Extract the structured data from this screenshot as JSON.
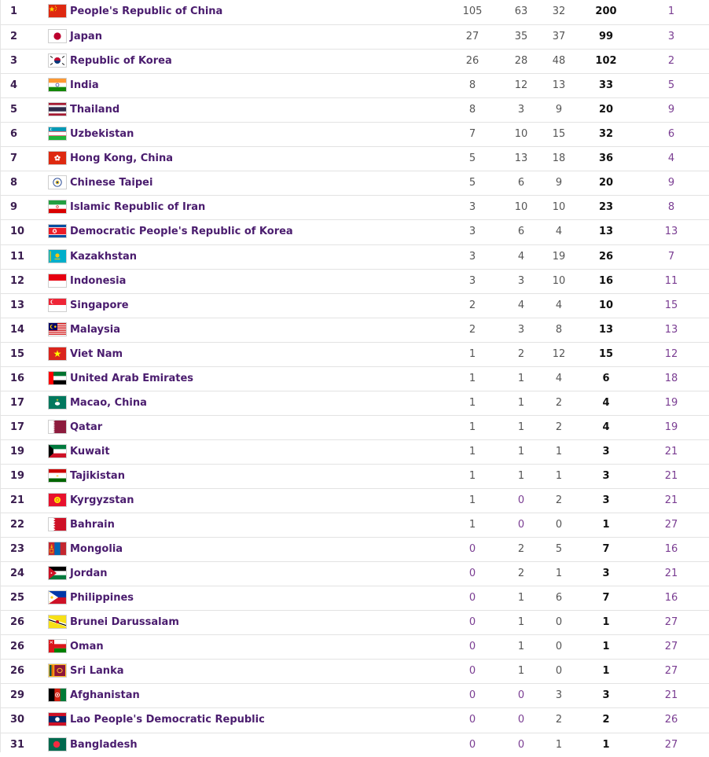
{
  "colors": {
    "name_text": "#4a1c6e",
    "rank_text": "#3a1d4f",
    "link_purple": "#7a3d92",
    "row_border": "#e3e3e3"
  },
  "rows": [
    {
      "rank": "1",
      "name": "People's Republic of China",
      "flag": "china-flag",
      "gold": "105",
      "silver": "63",
      "bronze": "32",
      "total": "200",
      "rank_by_total": "1"
    },
    {
      "rank": "2",
      "name": "Japan",
      "flag": "japan-flag",
      "gold": "27",
      "silver": "35",
      "bronze": "37",
      "total": "99",
      "rank_by_total": "3"
    },
    {
      "rank": "3",
      "name": "Republic of Korea",
      "flag": "south-korea-flag",
      "gold": "26",
      "silver": "28",
      "bronze": "48",
      "total": "102",
      "rank_by_total": "2"
    },
    {
      "rank": "4",
      "name": "India",
      "flag": "india-flag",
      "gold": "8",
      "silver": "12",
      "bronze": "13",
      "total": "33",
      "rank_by_total": "5"
    },
    {
      "rank": "5",
      "name": "Thailand",
      "flag": "thailand-flag",
      "gold": "8",
      "silver": "3",
      "bronze": "9",
      "total": "20",
      "rank_by_total": "9"
    },
    {
      "rank": "6",
      "name": "Uzbekistan",
      "flag": "uzbekistan-flag",
      "gold": "7",
      "silver": "10",
      "bronze": "15",
      "total": "32",
      "rank_by_total": "6"
    },
    {
      "rank": "7",
      "name": "Hong Kong, China",
      "flag": "hong-kong-flag",
      "gold": "5",
      "silver": "13",
      "bronze": "18",
      "total": "36",
      "rank_by_total": "4"
    },
    {
      "rank": "8",
      "name": "Chinese Taipei",
      "flag": "chinese-taipei-flag",
      "gold": "5",
      "silver": "6",
      "bronze": "9",
      "total": "20",
      "rank_by_total": "9"
    },
    {
      "rank": "9",
      "name": "Islamic Republic of Iran",
      "flag": "iran-flag",
      "gold": "3",
      "silver": "10",
      "bronze": "10",
      "total": "23",
      "rank_by_total": "8"
    },
    {
      "rank": "10",
      "name": "Democratic People's Republic of Korea",
      "flag": "north-korea-flag",
      "gold": "3",
      "silver": "6",
      "bronze": "4",
      "total": "13",
      "rank_by_total": "13"
    },
    {
      "rank": "11",
      "name": "Kazakhstan",
      "flag": "kazakhstan-flag",
      "gold": "3",
      "silver": "4",
      "bronze": "19",
      "total": "26",
      "rank_by_total": "7"
    },
    {
      "rank": "12",
      "name": "Indonesia",
      "flag": "indonesia-flag",
      "gold": "3",
      "silver": "3",
      "bronze": "10",
      "total": "16",
      "rank_by_total": "11"
    },
    {
      "rank": "13",
      "name": "Singapore",
      "flag": "singapore-flag",
      "gold": "2",
      "silver": "4",
      "bronze": "4",
      "total": "10",
      "rank_by_total": "15"
    },
    {
      "rank": "14",
      "name": "Malaysia",
      "flag": "malaysia-flag",
      "gold": "2",
      "silver": "3",
      "bronze": "8",
      "total": "13",
      "rank_by_total": "13"
    },
    {
      "rank": "15",
      "name": "Viet Nam",
      "flag": "vietnam-flag",
      "gold": "1",
      "silver": "2",
      "bronze": "12",
      "total": "15",
      "rank_by_total": "12"
    },
    {
      "rank": "16",
      "name": "United Arab Emirates",
      "flag": "uae-flag",
      "gold": "1",
      "silver": "1",
      "bronze": "4",
      "total": "6",
      "rank_by_total": "18"
    },
    {
      "rank": "17",
      "name": "Macao, China",
      "flag": "macao-flag",
      "gold": "1",
      "silver": "1",
      "bronze": "2",
      "total": "4",
      "rank_by_total": "19"
    },
    {
      "rank": "17",
      "name": "Qatar",
      "flag": "qatar-flag",
      "gold": "1",
      "silver": "1",
      "bronze": "2",
      "total": "4",
      "rank_by_total": "19"
    },
    {
      "rank": "19",
      "name": "Kuwait",
      "flag": "kuwait-flag",
      "gold": "1",
      "silver": "1",
      "bronze": "1",
      "total": "3",
      "rank_by_total": "21"
    },
    {
      "rank": "19",
      "name": "Tajikistan",
      "flag": "tajikistan-flag",
      "gold": "1",
      "silver": "1",
      "bronze": "1",
      "total": "3",
      "rank_by_total": "21"
    },
    {
      "rank": "21",
      "name": "Kyrgyzstan",
      "flag": "kyrgyzstan-flag",
      "gold": "1",
      "silver": "0",
      "bronze": "2",
      "total": "3",
      "rank_by_total": "21"
    },
    {
      "rank": "22",
      "name": "Bahrain",
      "flag": "bahrain-flag",
      "gold": "1",
      "silver": "0",
      "bronze": "0",
      "total": "1",
      "rank_by_total": "27"
    },
    {
      "rank": "23",
      "name": "Mongolia",
      "flag": "mongolia-flag",
      "gold": "0",
      "silver": "2",
      "bronze": "5",
      "total": "7",
      "rank_by_total": "16"
    },
    {
      "rank": "24",
      "name": "Jordan",
      "flag": "jordan-flag",
      "gold": "0",
      "silver": "2",
      "bronze": "1",
      "total": "3",
      "rank_by_total": "21"
    },
    {
      "rank": "25",
      "name": "Philippines",
      "flag": "philippines-flag",
      "gold": "0",
      "silver": "1",
      "bronze": "6",
      "total": "7",
      "rank_by_total": "16"
    },
    {
      "rank": "26",
      "name": "Brunei Darussalam",
      "flag": "brunei-flag",
      "gold": "0",
      "silver": "1",
      "bronze": "0",
      "total": "1",
      "rank_by_total": "27"
    },
    {
      "rank": "26",
      "name": "Oman",
      "flag": "oman-flag",
      "gold": "0",
      "silver": "1",
      "bronze": "0",
      "total": "1",
      "rank_by_total": "27"
    },
    {
      "rank": "26",
      "name": "Sri Lanka",
      "flag": "sri-lanka-flag",
      "gold": "0",
      "silver": "1",
      "bronze": "0",
      "total": "1",
      "rank_by_total": "27"
    },
    {
      "rank": "29",
      "name": "Afghanistan",
      "flag": "afghanistan-flag",
      "gold": "0",
      "silver": "0",
      "bronze": "3",
      "total": "3",
      "rank_by_total": "21"
    },
    {
      "rank": "30",
      "name": "Lao People's Democratic Republic",
      "flag": "laos-flag",
      "gold": "0",
      "silver": "0",
      "bronze": "2",
      "total": "2",
      "rank_by_total": "26"
    },
    {
      "rank": "31",
      "name": "Bangladesh",
      "flag": "bangladesh-flag",
      "gold": "0",
      "silver": "0",
      "bronze": "1",
      "total": "1",
      "rank_by_total": "27"
    }
  ]
}
